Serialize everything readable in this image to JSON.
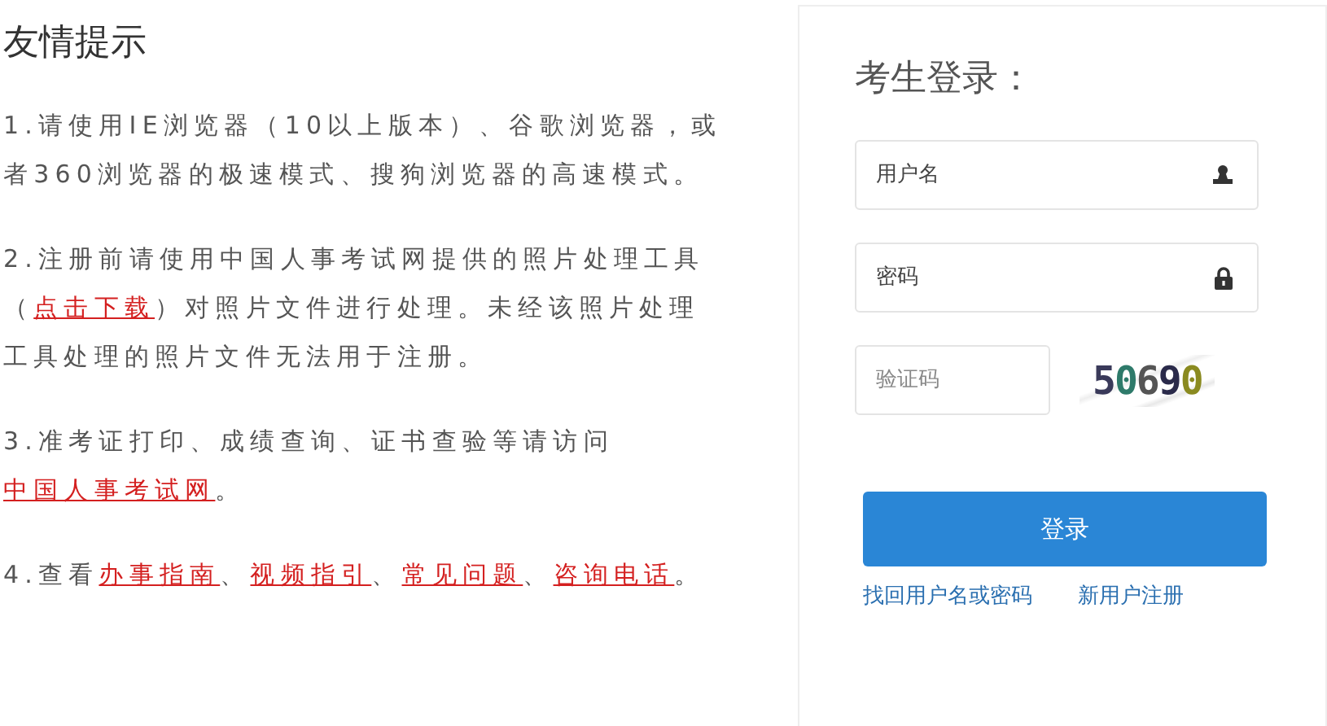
{
  "tips": {
    "title": "友情提示",
    "items": [
      {
        "parts": [
          {
            "kind": "text",
            "text": "1.请使用IE浏览器（10以上版本）、谷歌浏览器，或者360浏览器的极速模式、搜狗浏览器的高速模式。"
          }
        ]
      },
      {
        "parts": [
          {
            "kind": "text",
            "text": "2.注册前请使用中国人事考试网提供的照片处理工具（"
          },
          {
            "kind": "link",
            "text": "点击下载"
          },
          {
            "kind": "text",
            "text": "）对照片文件进行处理。未经该照片处理工具处理的照片文件无法用于注册。"
          }
        ]
      },
      {
        "parts": [
          {
            "kind": "text",
            "text": "3.准考证打印、成绩查询、证书查验等请访问"
          },
          {
            "kind": "link",
            "text": "中国人事考试网"
          },
          {
            "kind": "text",
            "text": "。"
          }
        ]
      },
      {
        "parts": [
          {
            "kind": "text",
            "text": "4.查看"
          },
          {
            "kind": "link",
            "text": "办事指南"
          },
          {
            "kind": "text",
            "text": "、"
          },
          {
            "kind": "link",
            "text": "视频指引"
          },
          {
            "kind": "text",
            "text": "、"
          },
          {
            "kind": "link",
            "text": "常见问题"
          },
          {
            "kind": "text",
            "text": "、"
          },
          {
            "kind": "link",
            "text": "咨询电话"
          },
          {
            "kind": "text",
            "text": "。"
          }
        ]
      }
    ]
  },
  "login": {
    "title": "考生登录：",
    "fields": [
      {
        "placeholder": "用户名",
        "kind": "user"
      },
      {
        "placeholder": "密码",
        "kind": "lock"
      }
    ],
    "captcha": {
      "placeholder": "验证码",
      "code": "50690"
    },
    "button": "登录",
    "links": [
      "找回用户名或密码",
      "新用户注册"
    ]
  }
}
